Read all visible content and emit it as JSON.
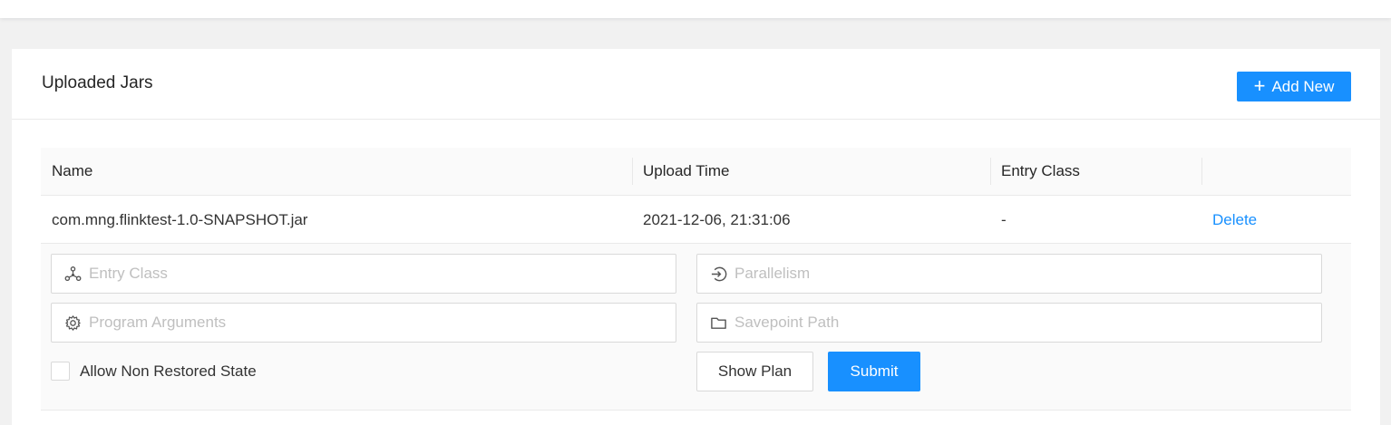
{
  "card": {
    "title": "Uploaded Jars",
    "add_button_label": "Add New"
  },
  "table": {
    "columns": [
      "Name",
      "Upload Time",
      "Entry Class",
      ""
    ],
    "rows": [
      {
        "name": "com.mng.flinktest-1.0-SNAPSHOT.jar",
        "upload_time": "2021-12-06, 21:31:06",
        "entry_class": "-",
        "action": "Delete"
      }
    ]
  },
  "form": {
    "entry_class_placeholder": "Entry Class",
    "parallelism_placeholder": "Parallelism",
    "program_arguments_placeholder": "Program Arguments",
    "savepoint_path_placeholder": "Savepoint Path",
    "allow_non_restored_label": "Allow Non Restored State",
    "allow_non_restored_checked": false,
    "show_plan_label": "Show Plan",
    "submit_label": "Submit"
  },
  "icons": {
    "add": "plus-icon",
    "entry_class": "cluster-icon",
    "parallelism": "login-arrow-icon",
    "program_arguments": "gear-icon",
    "savepoint_path": "folder-icon"
  },
  "colors": {
    "primary": "#1890ff",
    "background": "#f1f1f1"
  }
}
